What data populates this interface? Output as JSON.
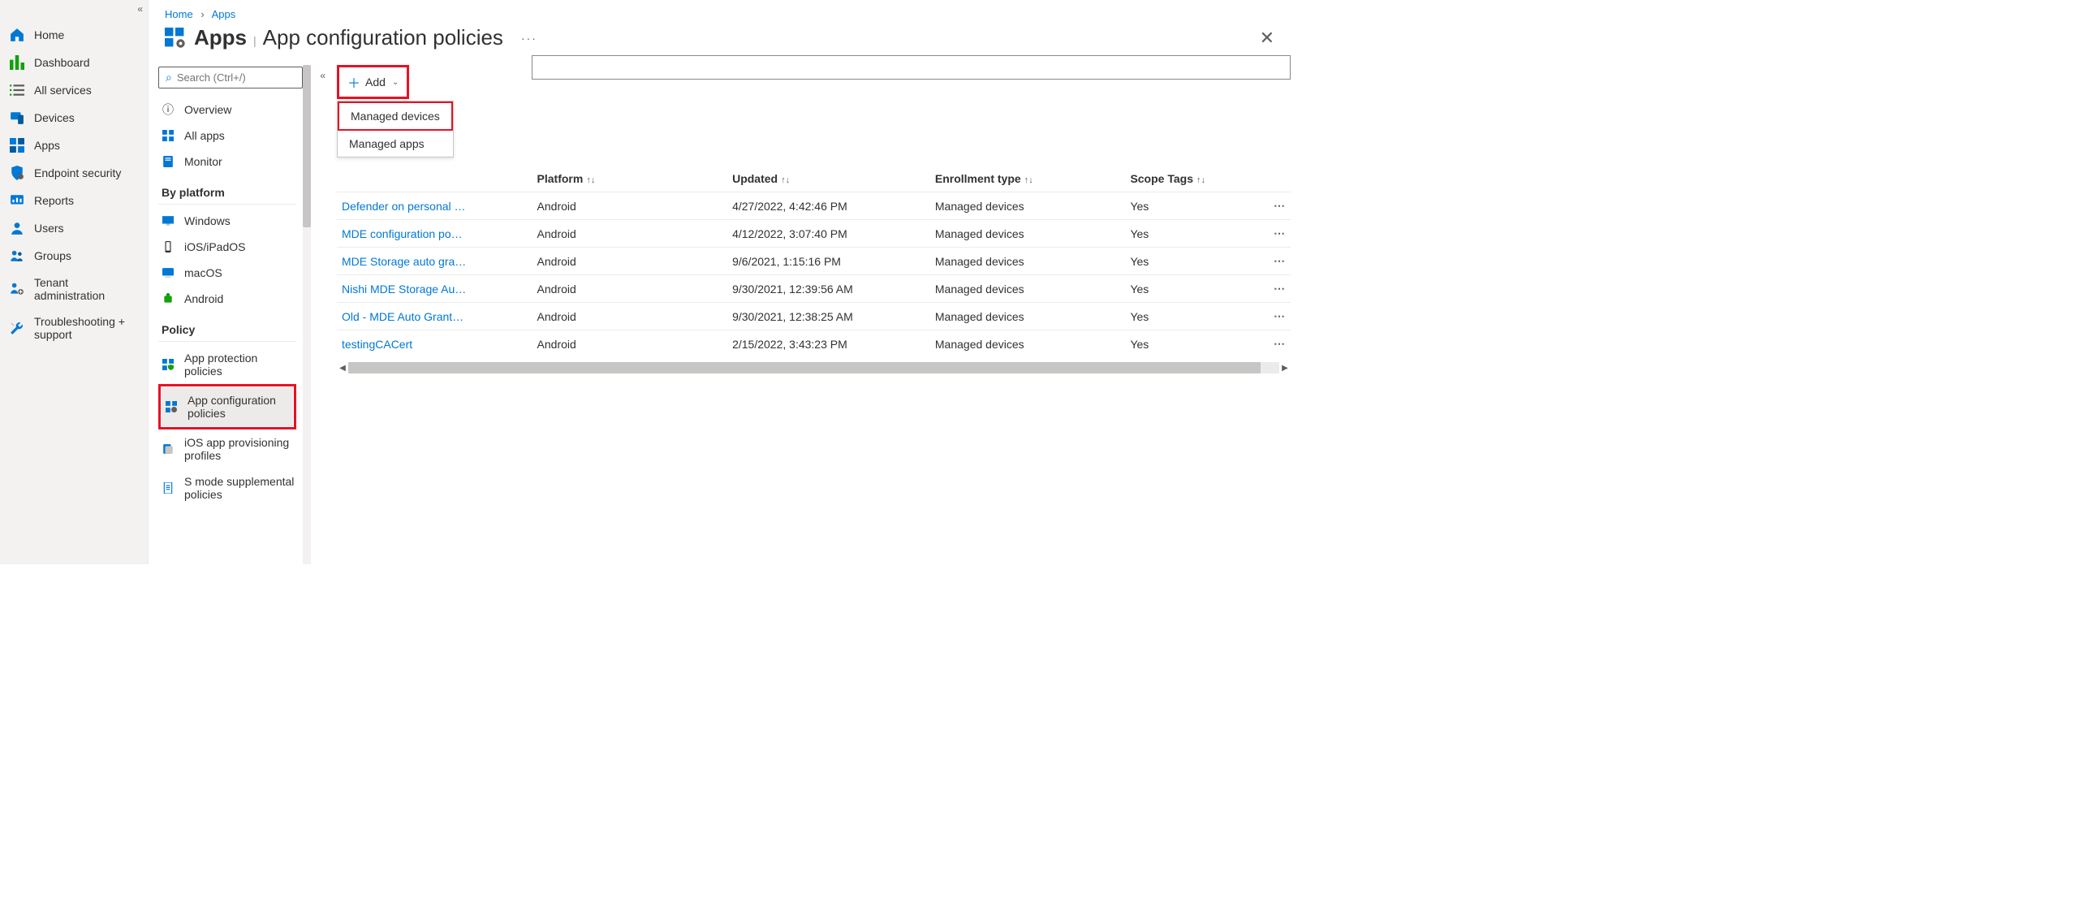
{
  "leftnav": {
    "items": [
      {
        "label": "Home",
        "icon": "home"
      },
      {
        "label": "Dashboard",
        "icon": "dashboard"
      },
      {
        "label": "All services",
        "icon": "list"
      },
      {
        "label": "Devices",
        "icon": "devices"
      },
      {
        "label": "Apps",
        "icon": "apps"
      },
      {
        "label": "Endpoint security",
        "icon": "shield"
      },
      {
        "label": "Reports",
        "icon": "reports"
      },
      {
        "label": "Users",
        "icon": "user"
      },
      {
        "label": "Groups",
        "icon": "group"
      },
      {
        "label": "Tenant administration",
        "icon": "tenant"
      },
      {
        "label": "Troubleshooting + support",
        "icon": "wrench"
      }
    ]
  },
  "breadcrumb": {
    "home": "Home",
    "apps": "Apps"
  },
  "header": {
    "title": "Apps",
    "subtitle": "App configuration policies"
  },
  "subnav": {
    "search_placeholder": "Search (Ctrl+/)",
    "top": [
      {
        "label": "Overview"
      },
      {
        "label": "All apps"
      },
      {
        "label": "Monitor"
      }
    ],
    "platform_heading": "By platform",
    "platforms": [
      {
        "label": "Windows"
      },
      {
        "label": "iOS/iPadOS"
      },
      {
        "label": "macOS"
      },
      {
        "label": "Android"
      }
    ],
    "policy_heading": "Policy",
    "policies": [
      {
        "label": "App protection policies"
      },
      {
        "label": "App configuration policies",
        "selected": true
      },
      {
        "label": "iOS app provisioning profiles"
      },
      {
        "label": "S mode supplemental policies"
      }
    ]
  },
  "cmdbar": {
    "add": "Add",
    "menu": [
      {
        "label": "Managed devices",
        "highlight": true
      },
      {
        "label": "Managed apps"
      }
    ]
  },
  "table": {
    "columns": [
      "",
      "Platform",
      "Updated",
      "Enrollment type",
      "Scope Tags"
    ],
    "rows": [
      {
        "name": "Defender on personal …",
        "platform": "Android",
        "updated": "4/27/2022, 4:42:46 PM",
        "enroll": "Managed devices",
        "scope": "Yes"
      },
      {
        "name": "MDE configuration po…",
        "platform": "Android",
        "updated": "4/12/2022, 3:07:40 PM",
        "enroll": "Managed devices",
        "scope": "Yes"
      },
      {
        "name": "MDE Storage auto gra…",
        "platform": "Android",
        "updated": "9/6/2021, 1:15:16 PM",
        "enroll": "Managed devices",
        "scope": "Yes"
      },
      {
        "name": "Nishi MDE Storage Au…",
        "platform": "Android",
        "updated": "9/30/2021, 12:39:56 AM",
        "enroll": "Managed devices",
        "scope": "Yes"
      },
      {
        "name": "Old - MDE Auto Grant…",
        "platform": "Android",
        "updated": "9/30/2021, 12:38:25 AM",
        "enroll": "Managed devices",
        "scope": "Yes"
      },
      {
        "name": "testingCACert",
        "platform": "Android",
        "updated": "2/15/2022, 3:43:23 PM",
        "enroll": "Managed devices",
        "scope": "Yes"
      }
    ]
  }
}
